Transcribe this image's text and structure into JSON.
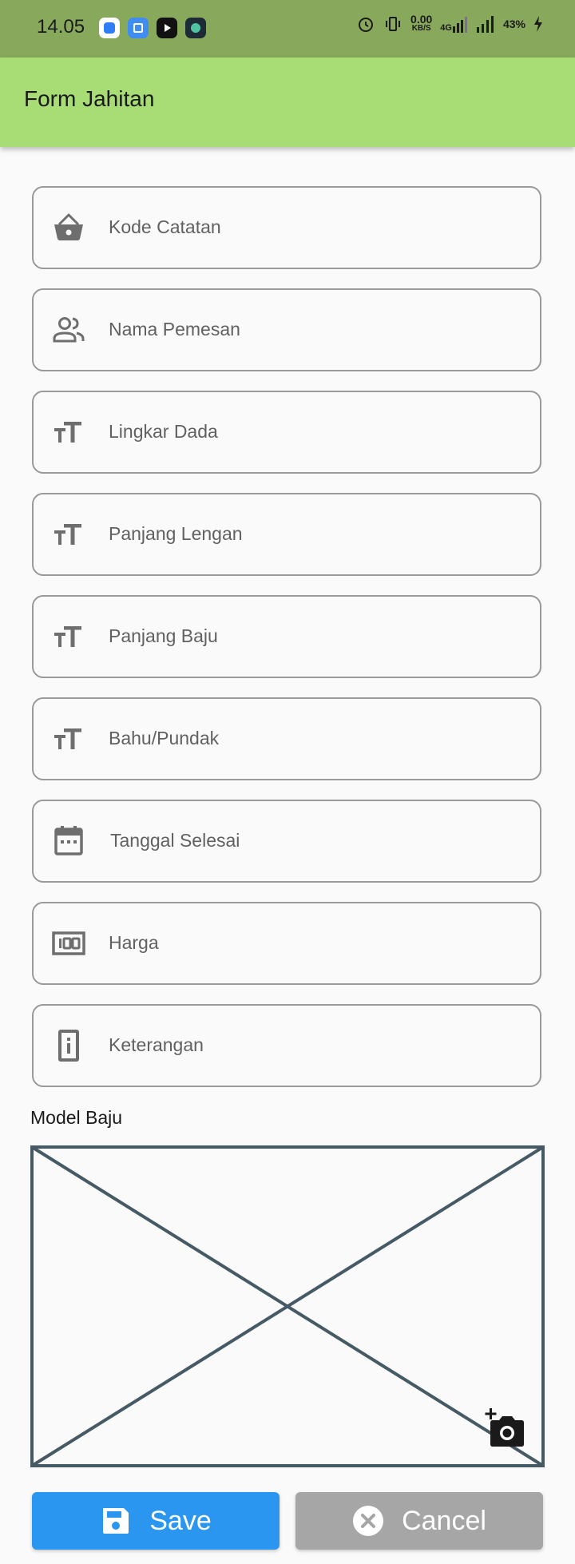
{
  "status_bar": {
    "time": "14.05",
    "net_speed": "0.00",
    "net_unit": "KB/S",
    "network_type": "4G",
    "battery": "43%"
  },
  "app_bar": {
    "title": "Form Jahitan"
  },
  "fields": [
    {
      "label": "Kode Catatan",
      "icon": "basket-icon"
    },
    {
      "label": "Nama Pemesan",
      "icon": "people-icon"
    },
    {
      "label": "Lingkar Dada",
      "icon": "text-size-icon"
    },
    {
      "label": "Panjang Lengan",
      "icon": "text-size-icon"
    },
    {
      "label": "Panjang Baju",
      "icon": "text-size-icon"
    },
    {
      "label": "Bahu/Pundak",
      "icon": "text-size-icon"
    },
    {
      "label": "Tanggal Selesai",
      "icon": "calendar-icon"
    },
    {
      "label": "Harga",
      "icon": "money-100-icon"
    },
    {
      "label": "Keterangan",
      "icon": "info-icon"
    }
  ],
  "model_section": {
    "label": "Model Baju",
    "icon": "add-photo-icon"
  },
  "buttons": {
    "save": {
      "label": "Save",
      "icon": "save-icon",
      "color": "#2b96f0"
    },
    "cancel": {
      "label": "Cancel",
      "icon": "cancel-icon",
      "color": "#a6a6a6"
    }
  },
  "colors": {
    "app_bar": "#a8dc74",
    "status_bar": "#88a85c",
    "icon_gray": "#6e6e6e"
  }
}
